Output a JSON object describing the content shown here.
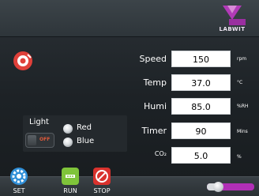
{
  "brand": {
    "name": "LABWIT",
    "accent": "#9a2fa0"
  },
  "record_button": {
    "icon": "record-icon",
    "color": "#e0403a"
  },
  "params": [
    {
      "label": "Speed",
      "value": "150",
      "unit": "rpm"
    },
    {
      "label": "Temp",
      "value": "37.0",
      "unit": "°C"
    },
    {
      "label": "Humi",
      "value": "85.0",
      "unit": "%RH"
    },
    {
      "label": "Timer",
      "value": "90",
      "unit": "Mins"
    },
    {
      "label": "CO₂",
      "value": "5.0",
      "unit": "%"
    }
  ],
  "light": {
    "title": "Light",
    "toggle_state": "OFF",
    "options": [
      {
        "label": "Red"
      },
      {
        "label": "Blue"
      }
    ]
  },
  "toolbar": {
    "set_label": "SET",
    "run_label": "RUN",
    "stop_label": "STOP",
    "set_icon": "gear-icon",
    "run_icon": "run-icon",
    "stop_icon": "stop-icon"
  },
  "slider": {
    "level": 0.17
  }
}
